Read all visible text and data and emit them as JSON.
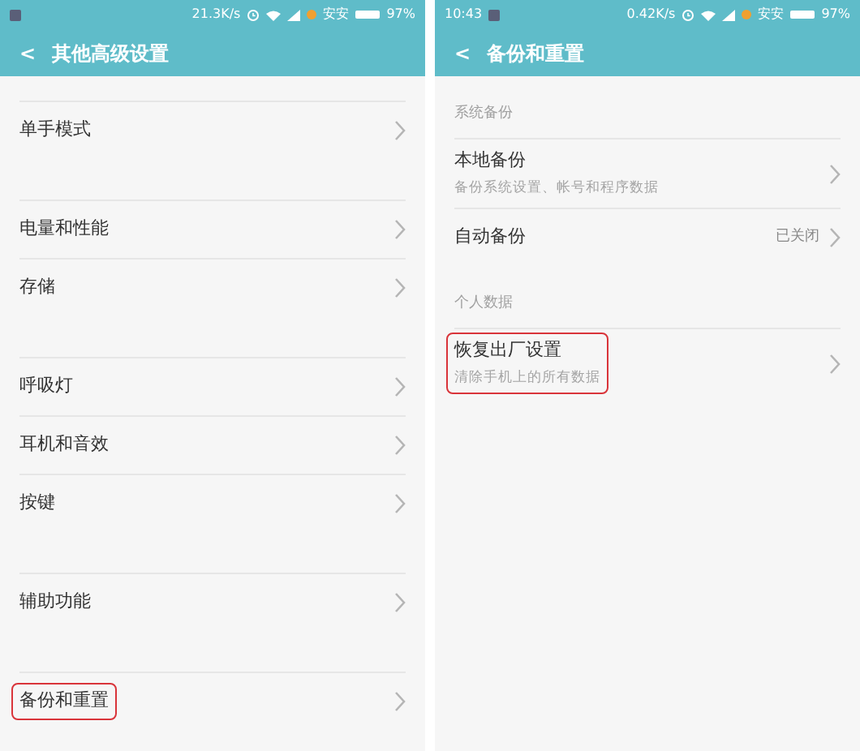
{
  "screens": [
    {
      "status_bar": {
        "speed": "21.3K/s",
        "carrier": "安安",
        "battery": "97%"
      },
      "title": "其他高级设置",
      "back": "<",
      "groups": [
        {
          "items": [
            {
              "label": "单手模式",
              "highlighted": false
            }
          ]
        },
        {
          "items": [
            {
              "label": "电量和性能",
              "highlighted": false
            },
            {
              "label": "存储",
              "highlighted": false
            }
          ]
        },
        {
          "items": [
            {
              "label": "呼吸灯",
              "highlighted": false
            },
            {
              "label": "耳机和音效",
              "highlighted": false
            },
            {
              "label": "按键",
              "highlighted": false
            }
          ]
        },
        {
          "items": [
            {
              "label": "辅助功能",
              "highlighted": false
            }
          ]
        },
        {
          "items": [
            {
              "label": "备份和重置",
              "highlighted": true
            }
          ]
        }
      ]
    },
    {
      "status_bar": {
        "time": "10:43",
        "speed": "0.42K/s",
        "carrier": "安安",
        "battery": "97%"
      },
      "title": "备份和重置",
      "back": "<",
      "groups": [
        {
          "header": "系统备份",
          "items": [
            {
              "label": "本地备份",
              "subtitle": "备份系统设置、帐号和程序数据",
              "highlighted": false
            },
            {
              "label": "自动备份",
              "value": "已关闭",
              "highlighted": false
            }
          ]
        },
        {
          "header": "个人数据",
          "items": [
            {
              "label": "恢复出厂设置",
              "subtitle": "清除手机上的所有数据",
              "highlighted": true
            }
          ]
        }
      ]
    }
  ]
}
